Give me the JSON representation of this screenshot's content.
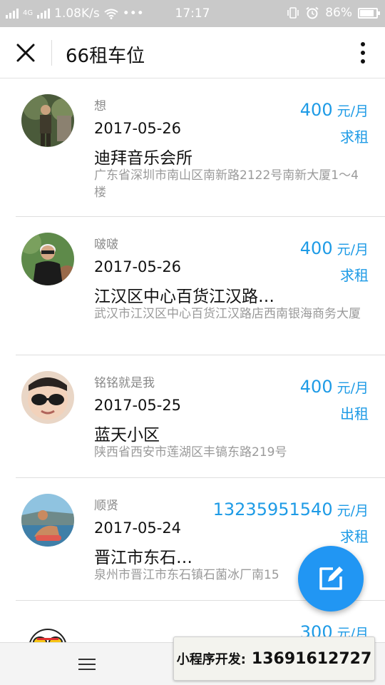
{
  "status_bar": {
    "network_speed": "1.08K/s",
    "network_type": "4G",
    "time": "17:17",
    "battery": "86%",
    "battery_level": 0.86
  },
  "navbar": {
    "title": "66租车位",
    "close_icon": "close-icon",
    "more_icon": "more-vertical-icon"
  },
  "listings": [
    {
      "nickname": "想",
      "date": "2017-05-26",
      "place": "迪拜音乐会所",
      "address": "广东省深圳市南山区南新路2122号南新大厦1～4楼",
      "price": "400",
      "unit": "元/月",
      "kind": "求租"
    },
    {
      "nickname": "啵啵",
      "date": "2017-05-26",
      "place": "江汉区中心百货江汉路…",
      "address": "武汉市江汉区中心百货江汉路店西南银海商务大厦",
      "price": "400",
      "unit": "元/月",
      "kind": "求租"
    },
    {
      "nickname": "铭铭就是我",
      "date": "2017-05-25",
      "place": "蓝天小区",
      "address": "陕西省西安市莲湖区丰镐东路219号",
      "price": "400",
      "unit": "元/月",
      "kind": "出租"
    },
    {
      "nickname": "顺贤",
      "date": "2017-05-24",
      "place": "晋江市东石…",
      "address": "泉州市晋江市东石镇石菌冰厂南15",
      "price": "13235951540",
      "unit": "元/月",
      "kind": "求租"
    },
    {
      "nickname": "",
      "price": "300",
      "unit": "元/月"
    }
  ],
  "ad_banner": {
    "label": "小程序开发:",
    "phone": "13691612727"
  },
  "fab_icon": "edit-icon",
  "tabbar_icon": "menu-icon",
  "colors": {
    "accent": "#1e9be6",
    "fab": "#2196f3",
    "status_bar": "#c9c9c9"
  }
}
